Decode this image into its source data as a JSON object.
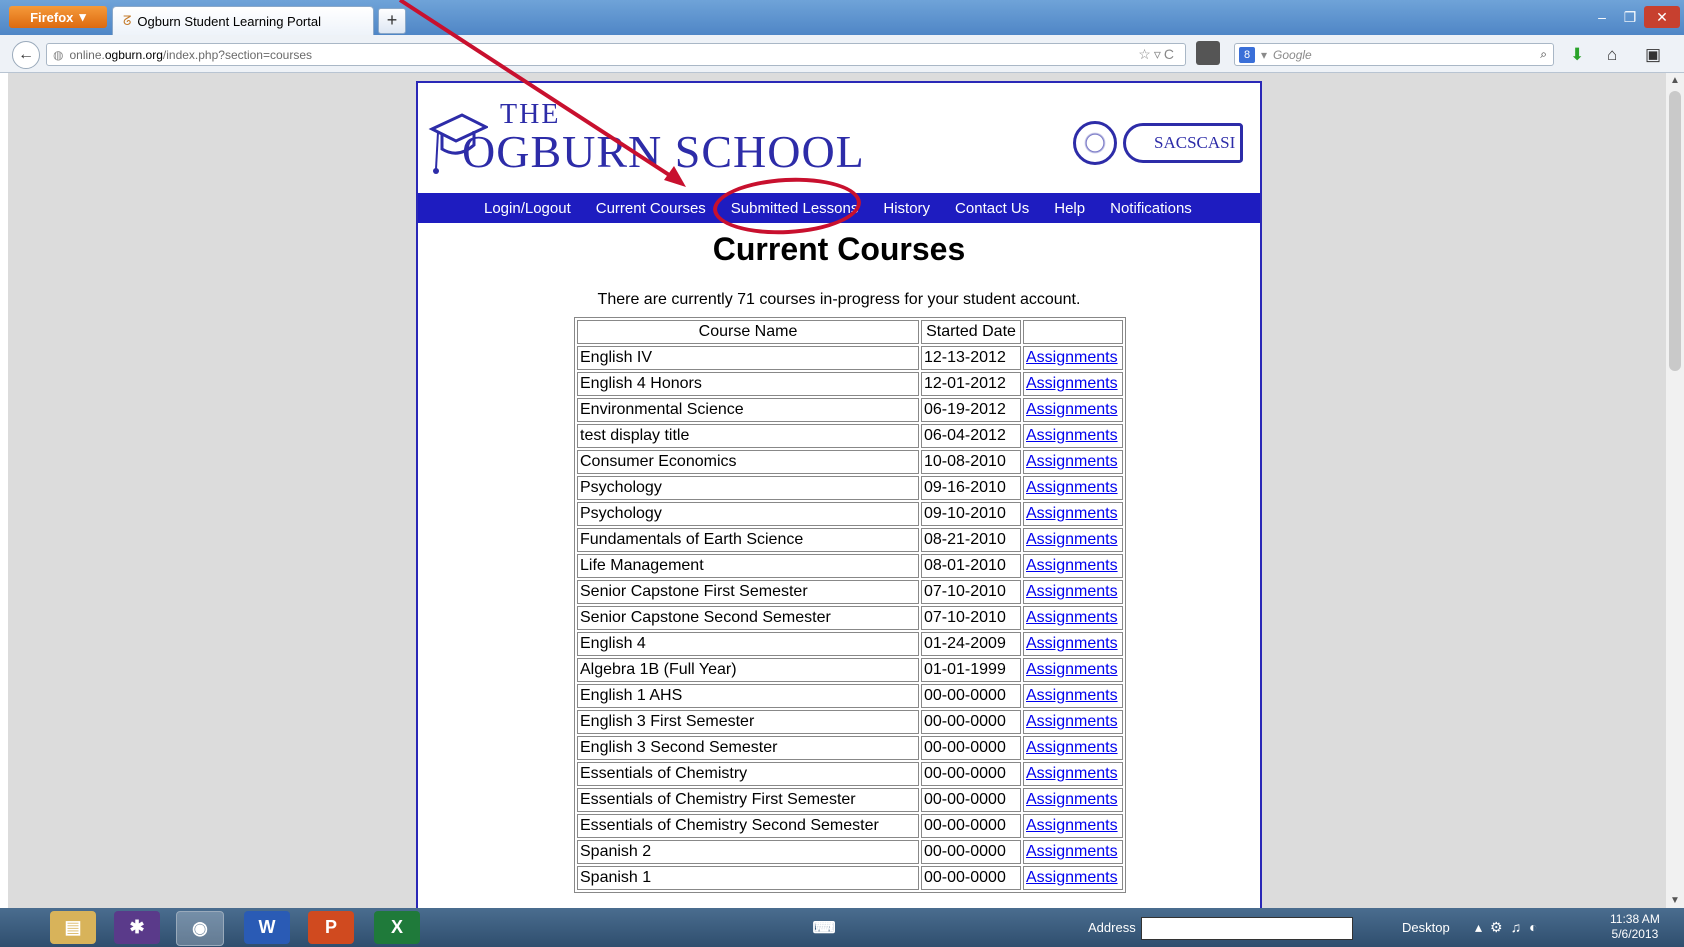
{
  "browser": {
    "menu_button": "Firefox",
    "tab_title": "Ogburn Student Learning Portal",
    "new_tab": "+",
    "url_prefix": "online.",
    "url_domain": "ogburn.org",
    "url_path": "/index.php?section=courses",
    "search_engine": "Google",
    "controls": {
      "minimize": "–",
      "restore": "❐",
      "close": "✕"
    }
  },
  "site": {
    "logo_the": "THE",
    "logo_name": "OGBURN SCHOOL",
    "accreditation": "SACSCASI",
    "nav": [
      "Login/Logout",
      "Current Courses",
      "Submitted Lessons",
      "History",
      "Contact Us",
      "Help",
      "Notifications"
    ]
  },
  "main": {
    "title": "Current Courses",
    "intro": "There are currently 71 courses in-progress for your student account.",
    "table": {
      "headers": [
        "Course Name",
        "Started Date",
        ""
      ],
      "link_label": "Assignments",
      "rows": [
        [
          "English IV",
          "12-13-2012"
        ],
        [
          "English 4 Honors",
          "12-01-2012"
        ],
        [
          "Environmental Science",
          "06-19-2012"
        ],
        [
          "test display title",
          "06-04-2012"
        ],
        [
          "Consumer Economics",
          "10-08-2010"
        ],
        [
          "Psychology",
          "09-16-2010"
        ],
        [
          "Psychology",
          "09-10-2010"
        ],
        [
          "Fundamentals of Earth Science",
          "08-21-2010"
        ],
        [
          "Life Management",
          "08-01-2010"
        ],
        [
          "Senior Capstone First Semester",
          "07-10-2010"
        ],
        [
          "Senior Capstone Second Semester",
          "07-10-2010"
        ],
        [
          "English 4",
          "01-24-2009"
        ],
        [
          "Algebra 1B (Full Year)",
          "01-01-1999"
        ],
        [
          "English 1 AHS",
          "00-00-0000"
        ],
        [
          "English 3 First Semester",
          "00-00-0000"
        ],
        [
          "English 3 Second Semester",
          "00-00-0000"
        ],
        [
          "Essentials of Chemistry",
          "00-00-0000"
        ],
        [
          "Essentials of Chemistry First Semester",
          "00-00-0000"
        ],
        [
          "Essentials of Chemistry Second Semester",
          "00-00-0000"
        ],
        [
          "Spanish 2",
          "00-00-0000"
        ],
        [
          "Spanish 1",
          "00-00-0000"
        ]
      ]
    }
  },
  "taskbar": {
    "apps": [
      "W",
      "P",
      "X"
    ],
    "address_label": "Address",
    "desktop_label": "Desktop",
    "time": "11:38 AM",
    "date": "5/6/2013"
  },
  "colors": {
    "annotation": "#c8102e",
    "site_blue": "#1e1cc0"
  }
}
